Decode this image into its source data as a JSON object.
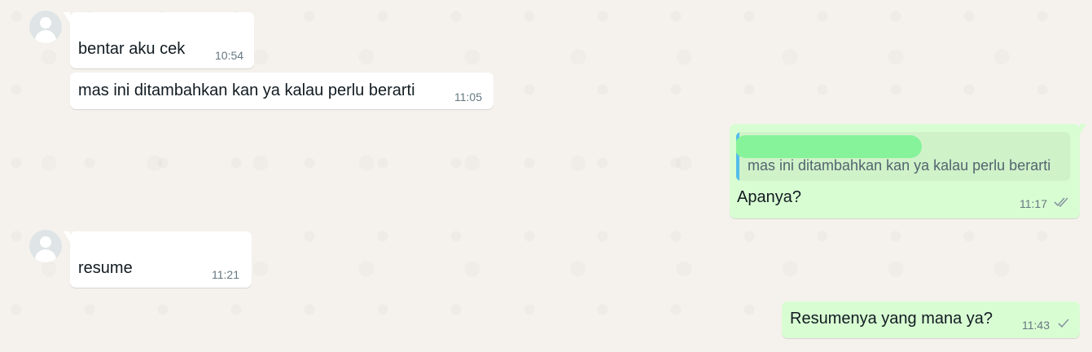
{
  "messages": [
    {
      "direction": "incoming",
      "text": "bentar aku cek",
      "time": "10:54"
    },
    {
      "direction": "incoming",
      "text": "mas ini ditambahkan kan ya kalau perlu berarti",
      "time": "11:05"
    },
    {
      "direction": "outgoing",
      "quote": {
        "text": "mas ini ditambahkan kan ya kalau perlu berarti"
      },
      "text": "Apanya?",
      "time": "11:17",
      "status": "read"
    },
    {
      "direction": "incoming",
      "text": "resume",
      "time": "11:21"
    },
    {
      "direction": "outgoing",
      "text": "Resumenya yang mana ya?",
      "time": "11:43",
      "status": "sent"
    }
  ],
  "colors": {
    "incoming_bubble": "#ffffff",
    "outgoing_bubble": "#d9fdd3",
    "quote_bar": "#53bdeb",
    "redaction": "#86f39a",
    "timestamp": "#667781"
  }
}
